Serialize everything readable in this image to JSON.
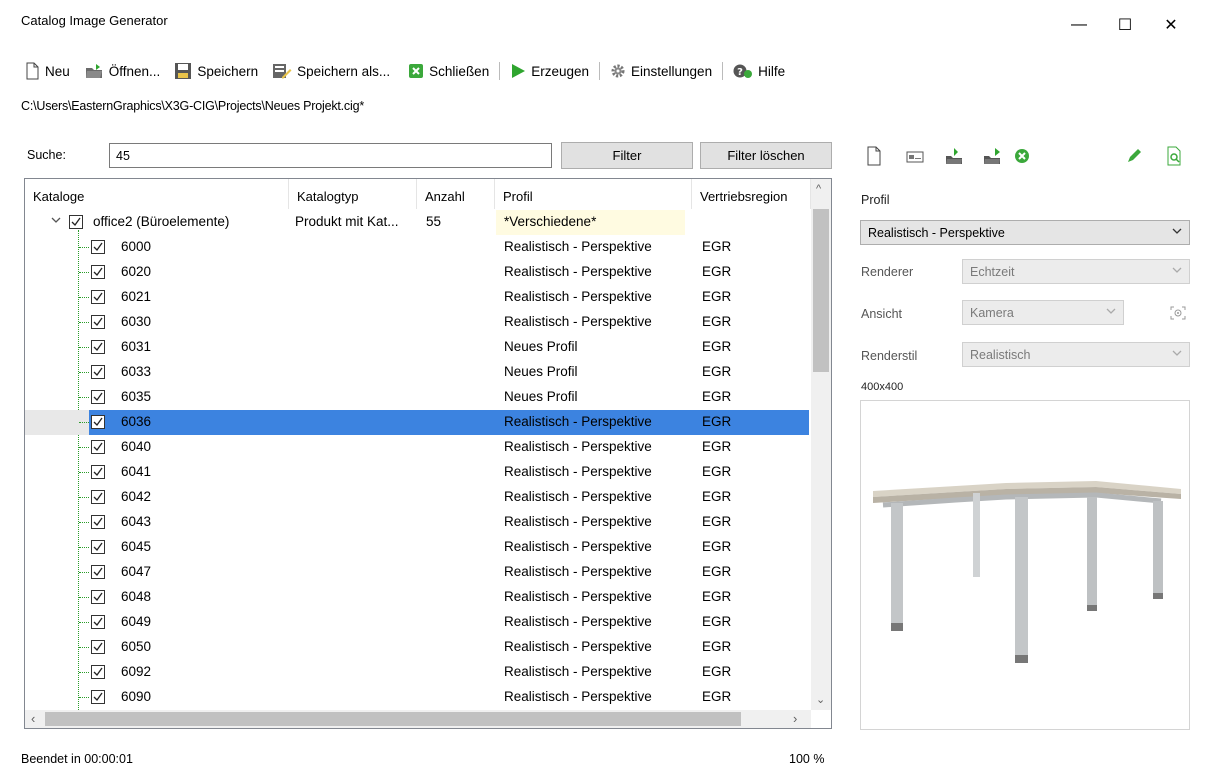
{
  "window": {
    "title": "Catalog Image Generator",
    "minimize_glyph": "—",
    "maximize_glyph": "☐",
    "close_glyph": "✕"
  },
  "toolbar": {
    "new_label": "Neu",
    "open_label": "Öffnen...",
    "save_label": "Speichern",
    "save_as_label": "Speichern als...",
    "close_label": "Schließen",
    "generate_label": "Erzeugen",
    "settings_label": "Einstellungen",
    "help_label": "Hilfe"
  },
  "project_path": "C:\\Users\\EasternGraphics\\X3G-CIG\\Projects\\Neues Projekt.cig*",
  "search": {
    "label": "Suche:",
    "value": "45",
    "filter_button": "Filter",
    "clear_filter_button": "Filter löschen"
  },
  "table": {
    "columns": [
      "Kataloge",
      "Katalogtyp",
      "Anzahl",
      "Profil",
      "Vertriebsregion"
    ],
    "root": {
      "name": "office2 (Büroelemente)",
      "type": "Produkt mit Kat...",
      "count": "55",
      "profile": "*Verschiedene*",
      "region": ""
    },
    "rows": [
      {
        "name": "6000",
        "profile": "Realistisch - Perspektive",
        "region": "EGR"
      },
      {
        "name": "6020",
        "profile": "Realistisch - Perspektive",
        "region": "EGR"
      },
      {
        "name": "6021",
        "profile": "Realistisch - Perspektive",
        "region": "EGR"
      },
      {
        "name": "6030",
        "profile": "Realistisch - Perspektive",
        "region": "EGR"
      },
      {
        "name": "6031",
        "profile": "Neues Profil",
        "region": "EGR"
      },
      {
        "name": "6033",
        "profile": "Neues Profil",
        "region": "EGR"
      },
      {
        "name": "6035",
        "profile": "Neues Profil",
        "region": "EGR"
      },
      {
        "name": "6036",
        "profile": "Realistisch - Perspektive",
        "region": "EGR",
        "selected": true
      },
      {
        "name": "6040",
        "profile": "Realistisch - Perspektive",
        "region": "EGR"
      },
      {
        "name": "6041",
        "profile": "Realistisch - Perspektive",
        "region": "EGR"
      },
      {
        "name": "6042",
        "profile": "Realistisch - Perspektive",
        "region": "EGR"
      },
      {
        "name": "6043",
        "profile": "Realistisch - Perspektive",
        "region": "EGR"
      },
      {
        "name": "6045",
        "profile": "Realistisch - Perspektive",
        "region": "EGR"
      },
      {
        "name": "6047",
        "profile": "Realistisch - Perspektive",
        "region": "EGR"
      },
      {
        "name": "6048",
        "profile": "Realistisch - Perspektive",
        "region": "EGR"
      },
      {
        "name": "6049",
        "profile": "Realistisch - Perspektive",
        "region": "EGR"
      },
      {
        "name": "6050",
        "profile": "Realistisch - Perspektive",
        "region": "EGR"
      },
      {
        "name": "6092",
        "profile": "Realistisch - Perspektive",
        "region": "EGR"
      },
      {
        "name": "6090",
        "profile": "Realistisch - Perspektive",
        "region": "EGR"
      }
    ]
  },
  "right_panel": {
    "profile_label": "Profil",
    "profile_value": "Realistisch - Perspektive",
    "renderer_label": "Renderer",
    "renderer_value": "Echtzeit",
    "view_label": "Ansicht",
    "view_value": "Kamera",
    "renderstyle_label": "Renderstil",
    "renderstyle_value": "Realistisch",
    "image_size": "400x400"
  },
  "status": {
    "message": "Beendet in 00:00:01",
    "progress": "100 %"
  },
  "colors": {
    "selection": "#3c83e0",
    "tree_lines": "#2a9d2a",
    "mixed_profile_bg": "#fffbe1"
  }
}
